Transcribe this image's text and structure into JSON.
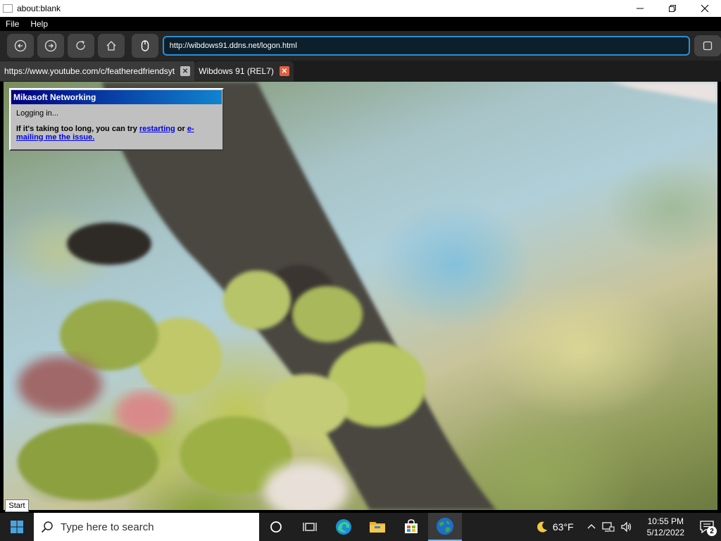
{
  "window": {
    "title": "about:blank"
  },
  "menu": {
    "items": [
      "File",
      "Help"
    ]
  },
  "toolbar": {
    "url": "http://wibdows91.ddns.net/logon.html"
  },
  "tabs": [
    {
      "label": "https://www.youtube.com/c/featheredfriendsyt",
      "active": false
    },
    {
      "label": "Wibdows 91 (REL7)",
      "active": true
    }
  ],
  "dialog": {
    "title": "Mikasoft Networking",
    "status": "Logging in...",
    "help_prefix": "If it's taking too long, you can try ",
    "link_restart": "restarting",
    "help_mid": " or ",
    "link_email": "e-mailing me the issue."
  },
  "start_tooltip": "Start",
  "taskbar": {
    "search_placeholder": "Type here to search",
    "weather": "63°F",
    "time": "10:55 PM",
    "date": "5/12/2022",
    "notification_count": "2"
  },
  "colors": {
    "accent": "#2a8fd6",
    "dialog_title_start": "#000080",
    "dialog_title_end": "#1084d0",
    "taskbar": "#1f1f1f"
  }
}
